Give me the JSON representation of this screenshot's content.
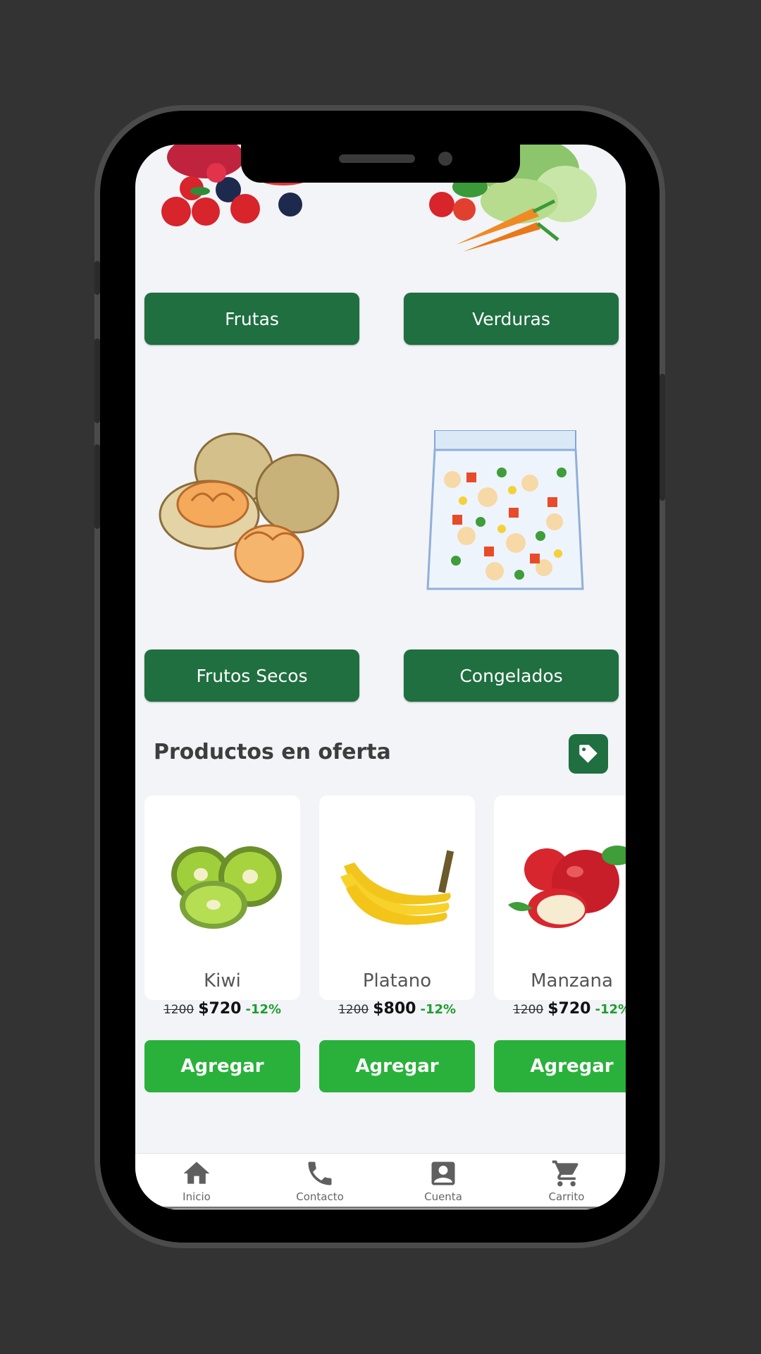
{
  "categories": [
    {
      "label": "Frutas",
      "icon": "berries-illustration"
    },
    {
      "label": "Verduras",
      "icon": "vegetables-illustration"
    },
    {
      "label": "Frutos Secos",
      "icon": "walnuts-illustration"
    },
    {
      "label": "Congelados",
      "icon": "frozen-vegetables-bag-illustration"
    }
  ],
  "offers": {
    "title": "Productos en oferta",
    "tag_icon": "tag-icon",
    "products": [
      {
        "name": "Kiwi",
        "old_price": "1200",
        "price": "$720",
        "discount": "-12%",
        "button": "Agregar",
        "image": "kiwi-image"
      },
      {
        "name": "Platano",
        "old_price": "1200",
        "price": "$800",
        "discount": "-12%",
        "button": "Agregar",
        "image": "banana-image"
      },
      {
        "name": "Manzana",
        "old_price": "1200",
        "price": "$720",
        "discount": "-12%",
        "button": "Agregar",
        "image": "apple-image"
      }
    ]
  },
  "nav": [
    {
      "label": "Inicio",
      "icon": "home-icon"
    },
    {
      "label": "Contacto",
      "icon": "phone-icon"
    },
    {
      "label": "Cuenta",
      "icon": "account-icon"
    },
    {
      "label": "Carrito",
      "icon": "cart-icon"
    }
  ],
  "colors": {
    "background": "#333333",
    "screen": "#f3f4f8",
    "category_button": "#1f6f40",
    "add_button": "#2ab13b",
    "discount": "#1e9e2e"
  }
}
